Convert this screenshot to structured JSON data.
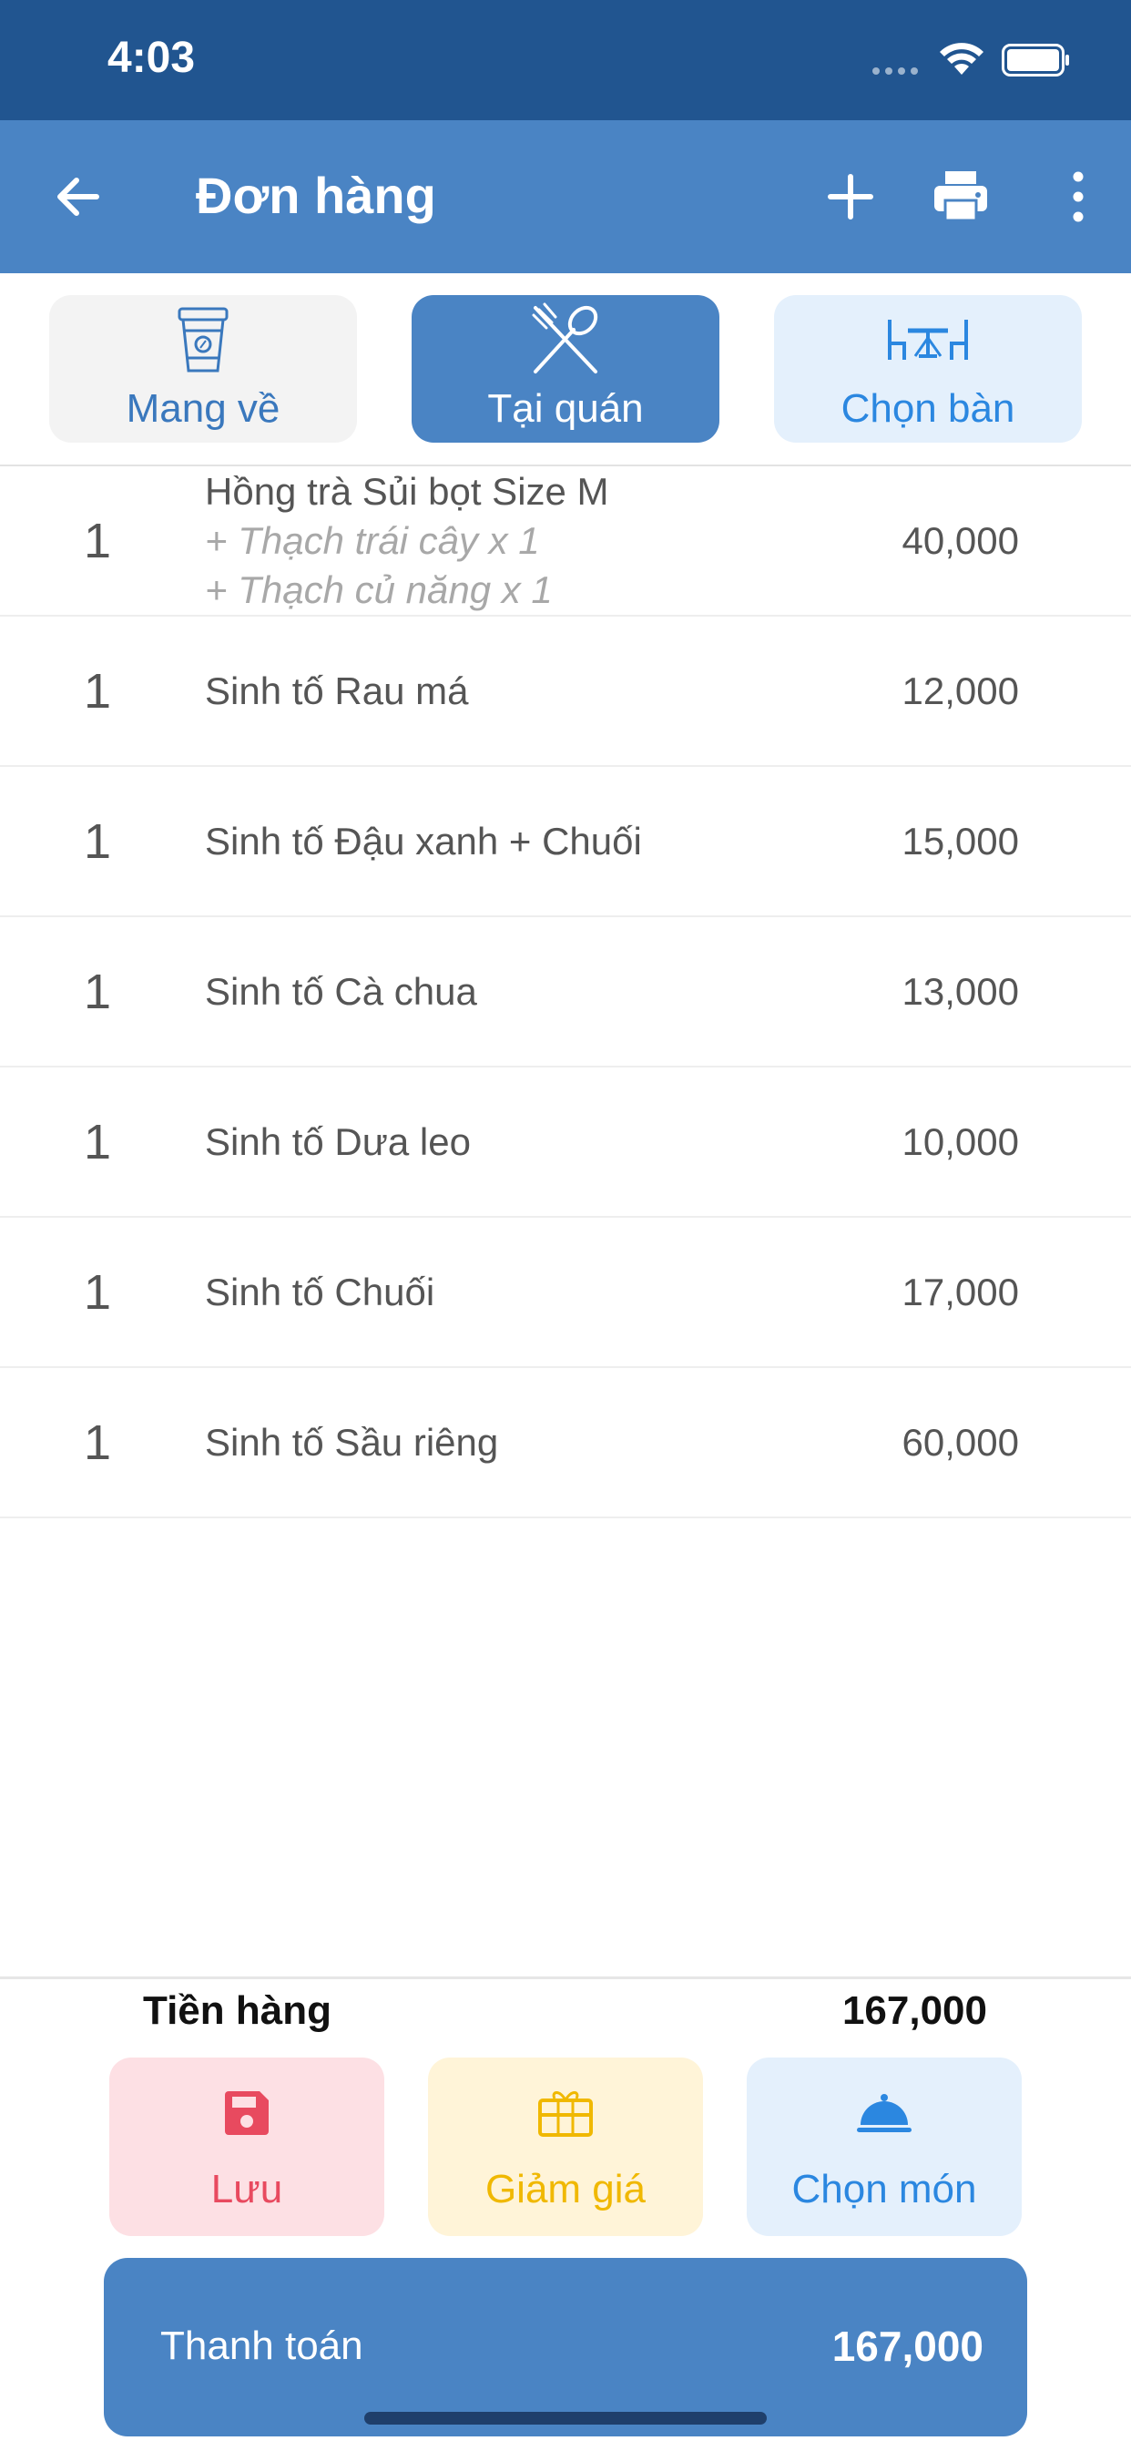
{
  "status_bar": {
    "time": "4:03"
  },
  "nav": {
    "title": "Đơn hàng"
  },
  "modes": [
    {
      "label": "Mang về",
      "icon": "takeaway-cup-icon"
    },
    {
      "label": "Tại quán",
      "icon": "fork-spoon-icon",
      "selected": true
    },
    {
      "label": "Chọn bàn",
      "icon": "table-chairs-icon"
    }
  ],
  "items": [
    {
      "qty": "1",
      "name": "Hồng trà Sủi bọt Size M",
      "options": [
        "+ Thạch trái cây x 1",
        "+ Thạch củ năng x 1"
      ],
      "price": "40,000"
    },
    {
      "qty": "1",
      "name": "Sinh tố Rau má",
      "price": "12,000"
    },
    {
      "qty": "1",
      "name": "Sinh tố Đậu xanh + Chuối",
      "price": "15,000"
    },
    {
      "qty": "1",
      "name": "Sinh tố Cà chua",
      "price": "13,000"
    },
    {
      "qty": "1",
      "name": "Sinh tố Dưa leo",
      "price": "10,000"
    },
    {
      "qty": "1",
      "name": "Sinh tố Chuối",
      "price": "17,000"
    },
    {
      "qty": "1",
      "name": "Sinh tố Sầu riêng",
      "price": "60,000"
    }
  ],
  "summary": {
    "label": "Tiền hàng",
    "value": "167,000"
  },
  "actions": {
    "save": "Lưu",
    "discount": "Giảm giá",
    "menu": "Chọn món"
  },
  "payment": {
    "label": "Thanh toán",
    "total": "167,000"
  },
  "colors": {
    "status_bar": "#215590",
    "primary": "#4a84c4",
    "accent_blue": "#2b87e0",
    "save_red": "#e84a5f",
    "discount_yellow": "#f0b800"
  }
}
